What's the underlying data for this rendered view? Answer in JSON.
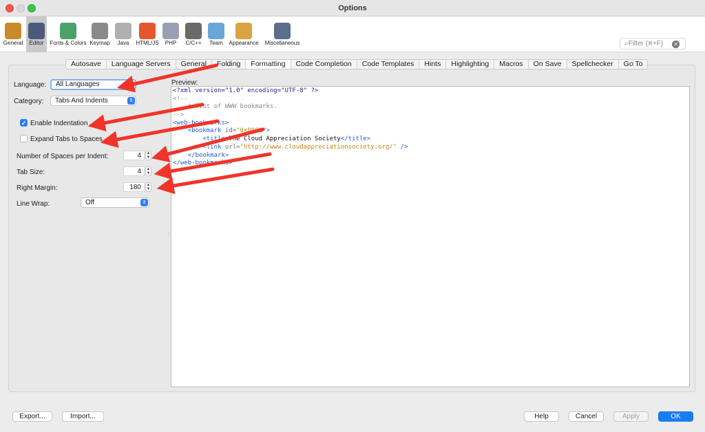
{
  "window": {
    "title": "Options"
  },
  "toolbar": {
    "items": [
      {
        "label": "General",
        "icon": "gear-wrench-icon",
        "color": "#c98a2c"
      },
      {
        "label": "Editor",
        "icon": "editor-pencil-icon",
        "color": "#4a5a7a",
        "selected": true
      },
      {
        "label": "Fonts & Colors",
        "icon": "fonts-colors-icon",
        "color": "#4aa36a"
      },
      {
        "label": "Keymap",
        "icon": "keymap-icon",
        "color": "#8a8a8a"
      },
      {
        "label": "Java",
        "icon": "java-cup-icon",
        "color": "#b0b0b0"
      },
      {
        "label": "HTML/JS",
        "icon": "html5-icon",
        "color": "#e4572e"
      },
      {
        "label": "PHP",
        "icon": "php-icon",
        "color": "#9aa0b4"
      },
      {
        "label": "C/C++",
        "icon": "cpp-icon",
        "color": "#6a6a6a"
      },
      {
        "label": "Team",
        "icon": "team-cubes-icon",
        "color": "#6aa7d8"
      },
      {
        "label": "Appearance",
        "icon": "appearance-icon",
        "color": "#d9a441"
      },
      {
        "label": "Miscellaneous",
        "icon": "miscellaneous-icon",
        "color": "#5c6e8a"
      }
    ],
    "filter_placeholder": "Filter (⌘+F)"
  },
  "tabs": [
    "Autosave",
    "Language Servers",
    "General",
    "Folding",
    "Formatting",
    "Code Completion",
    "Code Templates",
    "Hints",
    "Highlighting",
    "Macros",
    "On Save",
    "Spellchecker",
    "Go To"
  ],
  "active_tab": "Formatting",
  "form": {
    "language_label": "Language:",
    "language_value": "All Languages",
    "category_label": "Category:",
    "category_value": "Tabs And Indents",
    "enable_indentation_label": "Enable Indentation",
    "enable_indentation_checked": true,
    "expand_tabs_label": "Expand Tabs to Spaces",
    "expand_tabs_checked": false,
    "spaces_per_indent_label": "Number of Spaces per Indent:",
    "spaces_per_indent_value": "4",
    "tab_size_label": "Tab Size:",
    "tab_size_value": "4",
    "right_margin_label": "Right Margin:",
    "right_margin_value": "180",
    "line_wrap_label": "Line Wrap:",
    "line_wrap_value": "Off"
  },
  "preview": {
    "label": "Preview:",
    "lines": [
      [
        [
          "pi",
          "<?xml version=\"1.0\" encoding=\"UTF-8\" ?>"
        ]
      ],
      [
        [
          "cmt",
          "<!--"
        ]
      ],
      [
        [
          "cmt",
          "    A list of WWW bookmarks."
        ]
      ],
      [
        [
          "cmt",
          "-->"
        ]
      ],
      [
        [
          "tag",
          "<web-bookmarks>"
        ]
      ],
      [
        [
          "tag",
          "    <bookmark "
        ],
        [
          "attr",
          "id="
        ],
        [
          "val",
          "\"0x0001\""
        ],
        [
          "tag",
          ">"
        ]
      ],
      [
        [
          "tag",
          "        <title>"
        ],
        [
          "txt",
          "The Cloud Appreciation Society"
        ],
        [
          "tag",
          "</title>"
        ]
      ],
      [
        [
          "tag",
          "        <link "
        ],
        [
          "attr",
          "url="
        ],
        [
          "val",
          "\"http://www.cloudappreciationsociety.org/\""
        ],
        [
          "tag",
          " />"
        ]
      ],
      [
        [
          "tag",
          "    </bookmark>"
        ]
      ],
      [
        [
          "tag",
          "</web-bookmarks>"
        ]
      ]
    ]
  },
  "buttons": {
    "export": "Export...",
    "import": "Import...",
    "help": "Help",
    "cancel": "Cancel",
    "apply": "Apply",
    "ok": "OK"
  },
  "colors": {
    "accent": "#1a7cf3",
    "annotation_arrow": "#f0342a"
  }
}
